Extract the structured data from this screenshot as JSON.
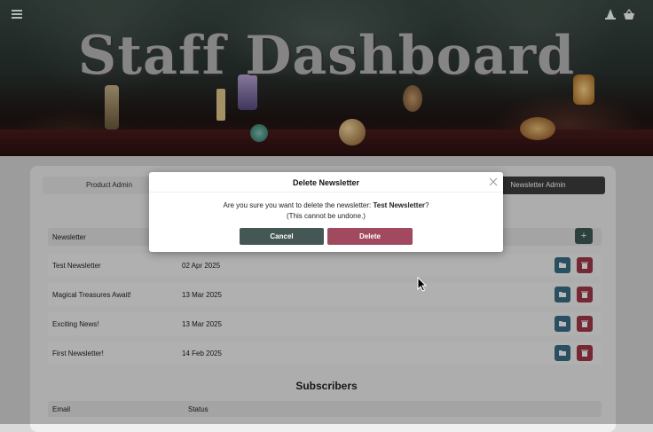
{
  "header": {
    "title": "Staff Dashboard",
    "menu_icon": "hamburger-menu-icon",
    "hat_icon": "wizard-hat-icon",
    "cart_icon": "shopping-basket-icon"
  },
  "tabs": {
    "product": "Product Admin",
    "newsletter": "Newsletter Admin"
  },
  "newsletters": {
    "column_header": "Newsletter",
    "add_icon": "+",
    "rows": [
      {
        "title": "Test Newsletter",
        "date": "02 Apr 2025"
      },
      {
        "title": "Magical Treasures Await!",
        "date": "13 Mar 2025"
      },
      {
        "title": "Exciting News!",
        "date": "13 Mar 2025"
      },
      {
        "title": "First Newsletter!",
        "date": "14 Feb 2025"
      }
    ]
  },
  "subscribers": {
    "title": "Subscribers",
    "col_email": "Email",
    "col_status": "Status"
  },
  "modal": {
    "title": "Delete Newsletter",
    "message_prefix": "Are you sure you want to delete the newsletter: ",
    "newsletter_name": "Test Newsletter",
    "message_suffix": "?",
    "note": "(This cannot be undone.)",
    "cancel_label": "Cancel",
    "delete_label": "Delete"
  },
  "colors": {
    "cancel": "#455754",
    "delete": "#a14a5f",
    "open_button": "#3a6e86",
    "delete_button": "#a03848",
    "active_tab": "#3e3e3e"
  }
}
